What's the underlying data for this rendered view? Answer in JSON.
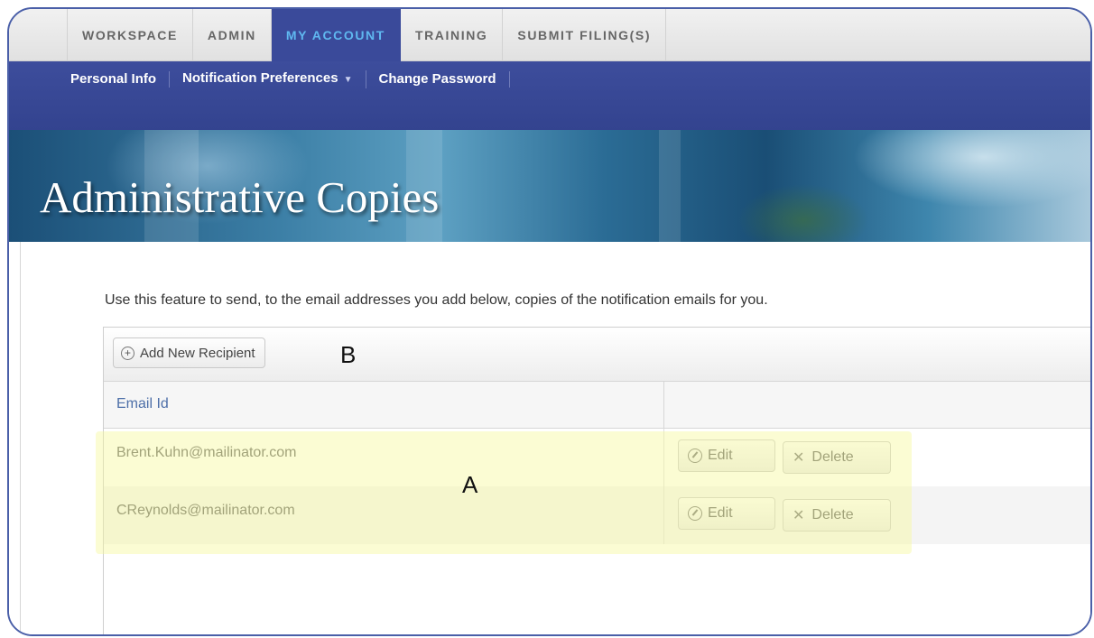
{
  "top_nav": {
    "tabs": [
      {
        "label": "WORKSPACE",
        "active": false
      },
      {
        "label": "ADMIN",
        "active": false
      },
      {
        "label": "MY ACCOUNT",
        "active": true
      },
      {
        "label": "TRAINING",
        "active": false
      },
      {
        "label": "SUBMIT FILING(S)",
        "active": false
      }
    ]
  },
  "sub_nav": {
    "items": [
      {
        "label": "Personal Info"
      },
      {
        "label": "Notification Preferences",
        "has_dropdown": true
      },
      {
        "label": "Change Password"
      }
    ],
    "dropdown_icon": "chevron-down-icon"
  },
  "banner": {
    "title": "Administrative Copies"
  },
  "intro_text": "Use this feature to send, to the email addresses you add below, copies of the notification emails for you.",
  "grid": {
    "toolbar": {
      "add_button_label": "Add New Recipient",
      "add_button_icon": "plus-circle-icon"
    },
    "columns": [
      "Email Id",
      ""
    ],
    "rows": [
      {
        "email": "Brent.Kuhn@mailinator.com",
        "edit_label": "Edit",
        "delete_label": "Delete"
      },
      {
        "email": "CReynolds@mailinator.com",
        "edit_label": "Edit",
        "delete_label": "Delete"
      }
    ]
  },
  "annotations": {
    "marker_a": "A",
    "marker_b": "B",
    "highlight_color": "#f6f896"
  },
  "colors": {
    "active_tab_bg": "#3a4a9a",
    "active_tab_text": "#5fb8f0",
    "subnav_bg": "#3d4d9c",
    "frame_border": "#4a5fa8",
    "header_text": "#4d6fa8"
  }
}
